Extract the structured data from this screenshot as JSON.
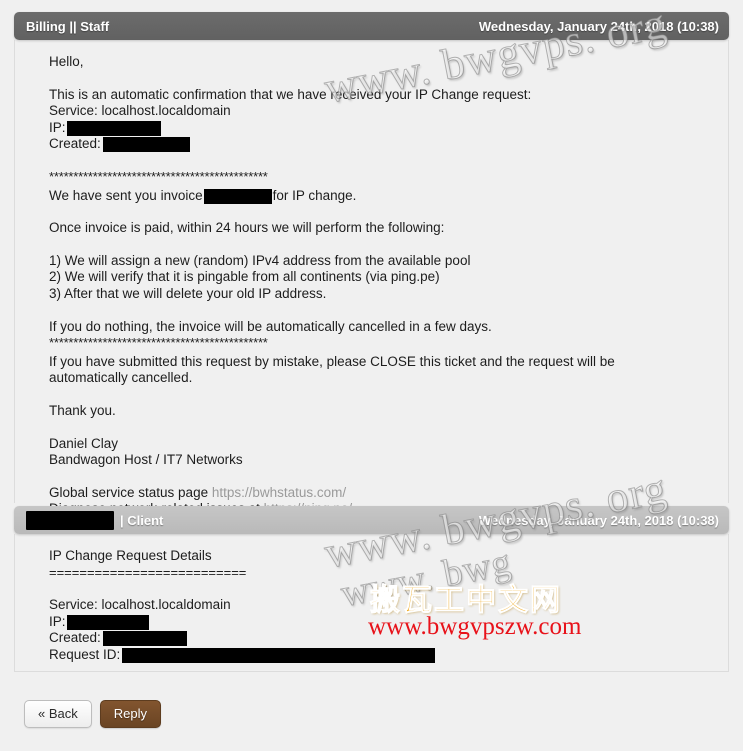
{
  "messages": [
    {
      "id": "staff-message",
      "role": "staff",
      "sender_label": "Billing || Staff",
      "sender_redacted": false,
      "date": "Wednesday, January 24th, 2018 (10:38)",
      "blocks": [
        {
          "type": "paragraph",
          "lines": [
            "Hello,"
          ]
        },
        {
          "type": "paragraph",
          "lines": [
            "This is an automatic confirmation that we have received your IP Change request:",
            "Service: localhost.localdomain",
            "IP: [redacted]",
            "Created: [redacted]"
          ]
        },
        {
          "type": "divider",
          "text": "*********************************************"
        },
        {
          "type": "paragraph",
          "lines": [
            "We have sent you invoice [redacted] for IP change."
          ]
        },
        {
          "type": "paragraph",
          "lines": [
            "Once invoice is paid, within 24 hours we will perform the following:"
          ]
        },
        {
          "type": "paragraph",
          "lines": [
            "1) We will assign a new (random) IPv4 address from the available pool",
            "2) We will verify that it is pingable from all continents (via ping.pe)",
            "3) After that we will delete your old IP address."
          ]
        },
        {
          "type": "paragraph",
          "lines": [
            "If you do nothing, the invoice will be automatically cancelled in a few days."
          ]
        },
        {
          "type": "divider",
          "text": "*********************************************"
        },
        {
          "type": "paragraph",
          "lines": [
            "If you have submitted this request by mistake, please CLOSE this ticket and the request will be",
            "automatically cancelled."
          ]
        },
        {
          "type": "paragraph",
          "lines": [
            "Thank you."
          ]
        },
        {
          "type": "paragraph",
          "lines": [
            "Daniel Clay",
            "Bandwagon Host / IT7 Networks"
          ]
        },
        {
          "type": "links",
          "lines": [
            {
              "text": "Global service status page ",
              "url": "https://bwhstatus.com/"
            },
            {
              "text": "Diagnose network-related issues at ",
              "url": "https://ping.pe/"
            }
          ]
        }
      ]
    },
    {
      "id": "client-message",
      "role": "client",
      "sender_label": "| Client",
      "sender_redacted": true,
      "date": "Wednesday, January 24th, 2018 (10:38)",
      "blocks": [
        {
          "type": "paragraph",
          "lines": [
            "IP Change Request Details"
          ]
        },
        {
          "type": "divider",
          "text": "=========================="
        },
        {
          "type": "paragraph",
          "lines": [
            "Service: localhost.localdomain",
            "IP: [redacted]",
            "Created: [redacted]",
            "Request ID: [redacted]"
          ]
        }
      ]
    }
  ],
  "text": {
    "staff_l_hello": "Hello,",
    "staff_l_confirm": "This is an automatic confirmation that we have received your IP Change request:",
    "staff_l_service": "Service: localhost.localdomain",
    "staff_l_ip_label": "IP:",
    "staff_l_created_label": "Created:",
    "staff_stars_1": "*********************************************",
    "staff_invoice_pre": "We have sent you invoice",
    "staff_invoice_post": "for IP change.",
    "staff_l_oncepaid": "Once invoice is paid, within 24 hours we will perform the following:",
    "staff_l_step1": "1) We will assign a new (random) IPv4 address from the available pool",
    "staff_l_step2": "2) We will verify that it is pingable from all continents (via ping.pe)",
    "staff_l_step3": "3) After that we will delete your old IP address.",
    "staff_l_donothing": "If you do nothing, the invoice will be automatically cancelled in a few days.",
    "staff_stars_2": "*********************************************",
    "staff_l_mistake1": "If you have submitted this request by mistake, please CLOSE this ticket and the request will be",
    "staff_l_mistake2": "automatically cancelled.",
    "staff_l_thanks": "Thank you.",
    "staff_l_signature1": "Daniel Clay",
    "staff_l_signature2": "Bandwagon Host / IT7 Networks",
    "staff_l_status_pre": "Global service status page ",
    "staff_l_status_url": "https://bwhstatus.com/",
    "staff_l_diag_pre": "Diagnose network-related issues at ",
    "staff_l_diag_url": "https://ping.pe/",
    "client_l_title": "IP Change Request Details",
    "client_equals": "==========================",
    "client_l_service": "Service: localhost.localdomain",
    "client_l_ip_label": "IP:",
    "client_l_created_label": "Created:",
    "client_l_request_label": "Request ID:"
  },
  "headers": {
    "staff_sender": "Billing || Staff",
    "staff_date": "Wednesday, January 24th, 2018 (10:38)",
    "client_sender": "| Client",
    "client_date": "Wednesday, January 24th, 2018 (10:38)"
  },
  "buttons": {
    "back_label": "« Back",
    "reply_label": "Reply"
  },
  "watermarks": {
    "domain_1": "www. bwgvps. org",
    "domain_2": "www. bwgvps. org",
    "domain_3": "www. bwg",
    "chinese": "搬瓦工中文网",
    "url": "www.bwgvpszw.com"
  },
  "colors": {
    "staff_header_bg": "#666666",
    "client_header_bg": "#bdbdbd",
    "page_bg": "#f0f0f0",
    "reply_button_bg": "#6a4423",
    "link_gray": "#9a9a9a",
    "watermark_orange": "#f0a81c",
    "watermark_red": "#e8121a"
  }
}
